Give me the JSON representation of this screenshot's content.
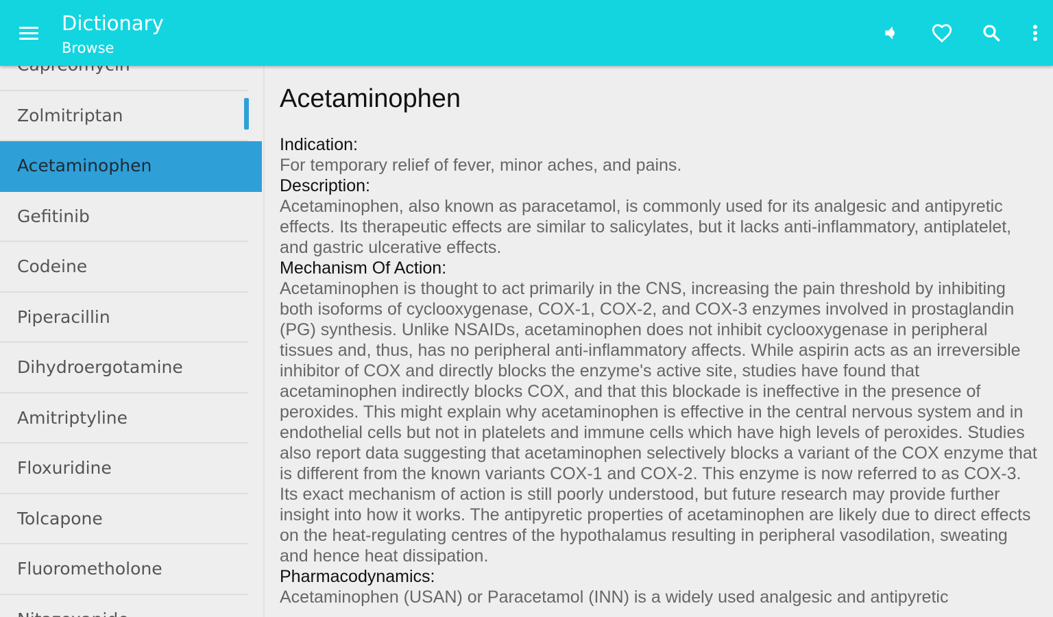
{
  "appbar": {
    "title": "Dictionary",
    "subtitle": "Browse",
    "icons": [
      "menu-icon",
      "volume-icon",
      "heart-icon",
      "search-icon",
      "more-vert-icon"
    ]
  },
  "sidebar": {
    "items": [
      {
        "label": "Capreomycin"
      },
      {
        "label": "Zolmitriptan"
      },
      {
        "label": "Acetaminophen"
      },
      {
        "label": "Gefitinib"
      },
      {
        "label": "Codeine"
      },
      {
        "label": "Piperacillin"
      },
      {
        "label": "Dihydroergotamine"
      },
      {
        "label": "Amitriptyline"
      },
      {
        "label": "Floxuridine"
      },
      {
        "label": "Tolcapone"
      },
      {
        "label": "Fluorometholone"
      },
      {
        "label": "Nitazoxanide"
      }
    ],
    "selected_index": 2
  },
  "entry": {
    "title": "Acetaminophen",
    "sections": [
      {
        "label": "Indication:",
        "text": "For temporary relief of fever, minor aches, and pains."
      },
      {
        "label": "Description:",
        "text": "Acetaminophen, also known as paracetamol, is commonly used for its analgesic and antipyretic effects. Its therapeutic effects are similar to salicylates, but it lacks anti-inflammatory, antiplatelet, and gastric ulcerative effects."
      },
      {
        "label": "Mechanism Of Action:",
        "text": "Acetaminophen is thought to act primarily in the CNS, increasing the pain threshold by inhibiting both isoforms of cyclooxygenase, COX-1, COX-2, and COX-3 enzymes involved in prostaglandin (PG) synthesis. Unlike NSAIDs, acetaminophen does not inhibit cyclooxygenase in peripheral tissues and, thus, has no peripheral anti-inflammatory affects. While aspirin acts as an irreversible inhibitor of COX and directly blocks the enzyme's active site, studies have found that acetaminophen indirectly blocks COX, and that this blockade is ineffective in the presence of peroxides. This might explain why acetaminophen is effective in the central nervous system and in endothelial cells but not in platelets and immune cells which have high levels of peroxides. Studies also report data suggesting that acetaminophen selectively blocks a variant of the COX enzyme that is different from the known variants COX-1 and COX-2. This enzyme is now referred to as COX-3. Its exact mechanism of action is still poorly understood, but future research may provide further insight into how it works. The antipyretic properties of acetaminophen are likely due to direct effects on the heat-regulating centres of the hypothalamus resulting in peripheral vasodilation, sweating and hence heat dissipation."
      },
      {
        "label": "Pharmacodynamics:",
        "text": "Acetaminophen (USAN) or Paracetamol (INN) is a widely used analgesic and antipyretic"
      }
    ]
  }
}
